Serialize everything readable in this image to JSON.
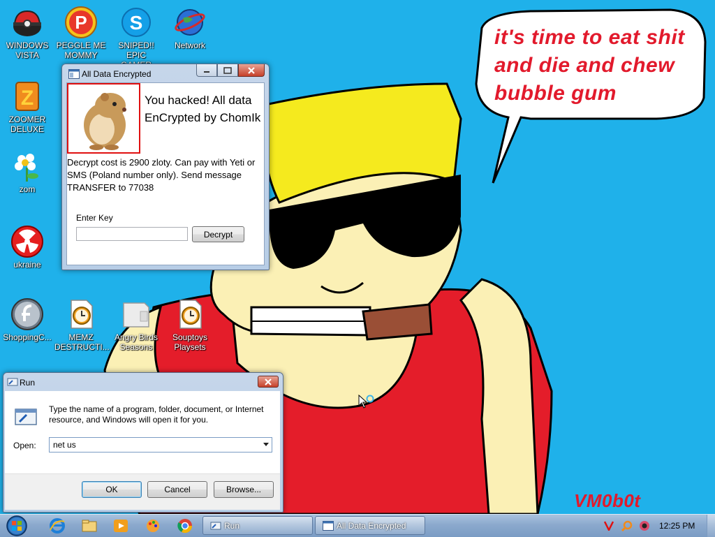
{
  "wallpaper": {
    "speech_line1": "it's time to eat shit",
    "speech_line2": "and die and chew",
    "speech_line3": "bubble gum",
    "watermark": "VM0b0t"
  },
  "desktop_icons": [
    {
      "id": "windows-vista",
      "label": "WINDOWS\nVISTA",
      "icon": "pokeball-icon"
    },
    {
      "id": "peggle",
      "label": "PEGGLE ME\nMOMMY",
      "icon": "peggle-icon"
    },
    {
      "id": "sniped",
      "label": "SNIPED!! EPIC\nGAMER 360...",
      "icon": "skype-icon"
    },
    {
      "id": "network",
      "label": "Network",
      "icon": "network-globe-icon"
    },
    {
      "id": "zoomer",
      "label": "ZOOMER\nDELUXE",
      "icon": "zuma-icon"
    },
    {
      "id": "zom",
      "label": "zom",
      "icon": "flower-icon"
    },
    {
      "id": "ukraine",
      "label": "ukraine",
      "icon": "radiation-icon"
    },
    {
      "id": "shopping",
      "label": "ShoppingC...",
      "icon": "flash-icon"
    },
    {
      "id": "memz",
      "label": "MEMZ\nDESTRUCTI...",
      "icon": "clock-file-icon"
    },
    {
      "id": "angry-birds",
      "label": "Angry Birds\nSeasons",
      "icon": "blank-file-icon"
    },
    {
      "id": "souptoys",
      "label": "Souptoys\nPlaysets",
      "icon": "clock-file-icon"
    }
  ],
  "ransom_window": {
    "title": "All Data Encrypted",
    "headline_line1": "You hacked! All data",
    "headline_line2": "EnCrypted by ChomIk",
    "message": "Decrypt cost is 2900 zloty. Can pay with Yeti or SMS (Poland number only). Send message TRANSFER to 77038",
    "key_label": "Enter Key",
    "key_value": "",
    "decrypt_button": "Decrypt"
  },
  "run_dialog": {
    "title": "Run",
    "description": "Type the name of a program, folder, document, or Internet resource, and Windows will open it for you.",
    "open_label": "Open:",
    "open_value": "net us",
    "ok_button": "OK",
    "cancel_button": "Cancel",
    "browse_button": "Browse..."
  },
  "taskbar": {
    "tasks": [
      {
        "label": "Run",
        "icon": "run-icon"
      },
      {
        "label": "All Data Encrypted",
        "icon": "window-icon"
      }
    ],
    "tray_icons": [
      "v-red-icon",
      "magnifier-orange-icon",
      "webcam-icon"
    ],
    "clock": "12:25 PM"
  },
  "colors": {
    "desktop_bg": "#1fb1ea",
    "speech_text": "#e21a2c",
    "shirt_red": "#e41d2a",
    "skin": "#fbf0b5",
    "hair": "#f5ea1e"
  }
}
